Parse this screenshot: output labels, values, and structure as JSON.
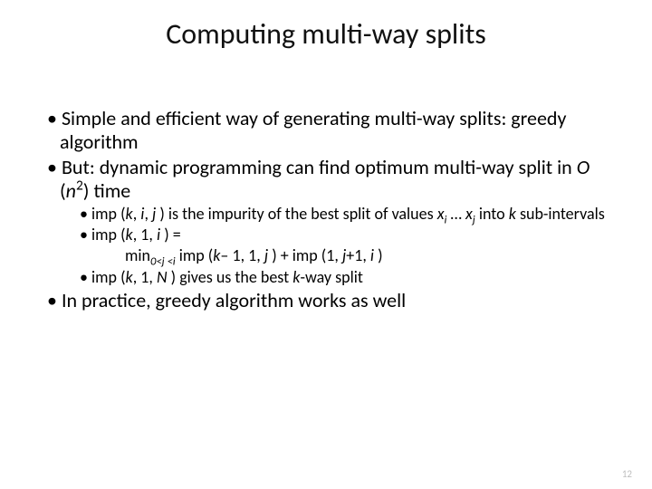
{
  "title": "Computing multi-way splits",
  "b1a": "Simple and efficient way of generating multi-way splits: greedy algorithm",
  "b2_pre": "But: dynamic programming can find optimum multi-way split in ",
  "b2_O": "O",
  "b2_paren_open": " (",
  "b2_n": "n",
  "b2_exp": "2",
  "b2_post": ") time",
  "s1_pre": "imp (",
  "s1_k": "k",
  "s1_c1": ", ",
  "s1_i": "i",
  "s1_c2": ", ",
  "s1_j": "j",
  "s1_mid": " ) is the impurity of the best split of values ",
  "s1_x1": "x",
  "s1_sub1": "i",
  "s1_dots": " … ",
  "s1_x2": "x",
  "s1_sub2": "j",
  "s1_post": " into ",
  "s1_k2": "k",
  "s1_end": " sub-intervals",
  "s2_pre": "imp (",
  "s2_k": "k",
  "s2_mid": ", 1, ",
  "s2_i": "i",
  "s2_post": " ) =",
  "s3_min": "min",
  "s3_sub": "0<j <i",
  "s3_sp": "  imp (",
  "s3_k": "k",
  "s3_mid1": "– 1, 1, ",
  "s3_j": "j",
  "s3_mid2": " ) + imp (1, ",
  "s3_j2": "j",
  "s3_mid3": "+1, ",
  "s3_i": "i",
  "s3_end": " )",
  "s4_pre": "imp (",
  "s4_k": "k",
  "s4_mid": ", 1, ",
  "s4_N": "N",
  "s4_post": " ) gives us the best ",
  "s4_k2": "k",
  "s4_end": "-way split",
  "b3": "In practice, greedy algorithm works as well",
  "page": "12"
}
